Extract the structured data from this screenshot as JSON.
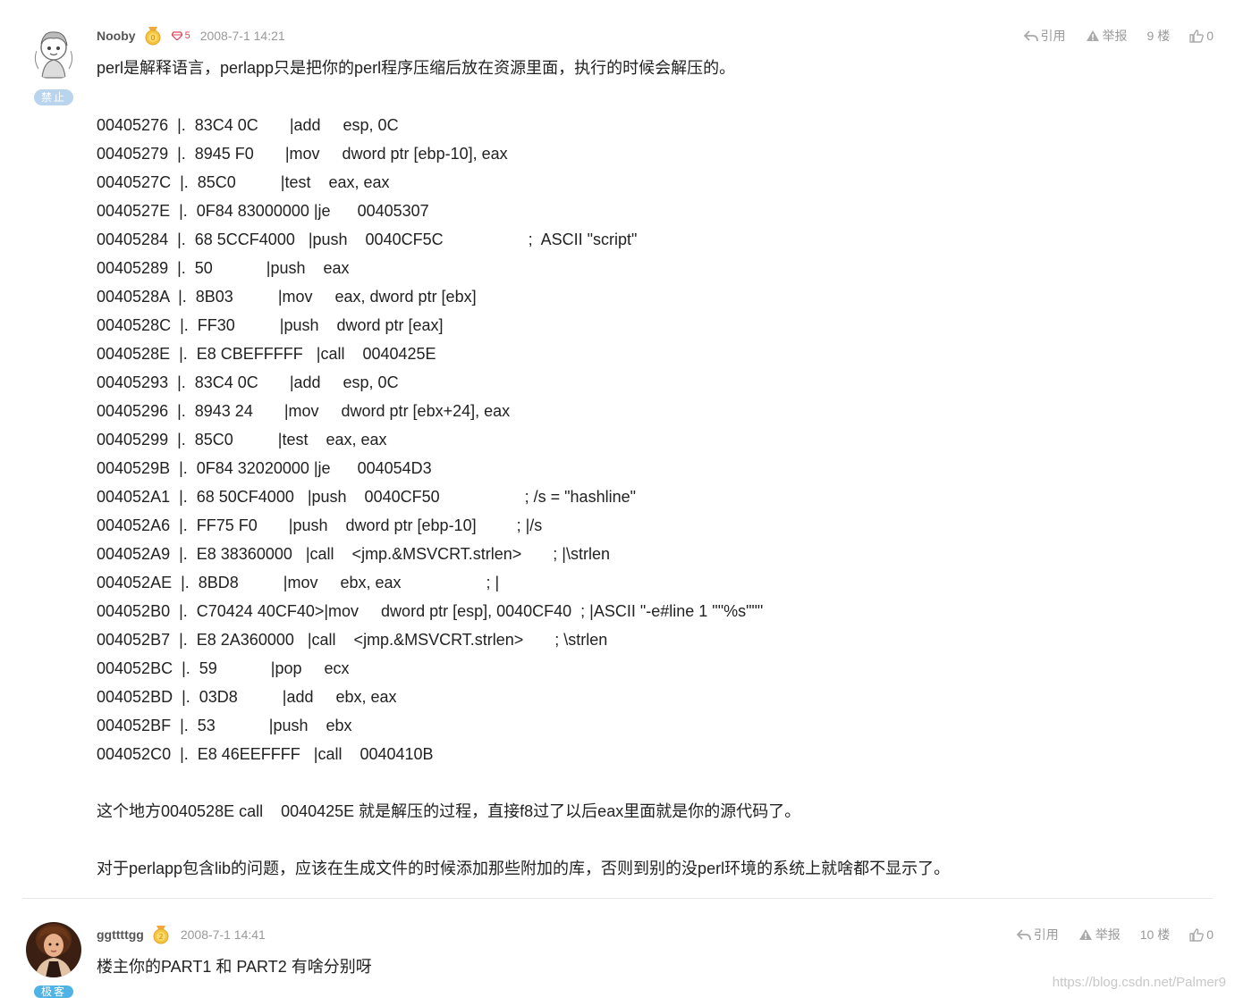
{
  "posts": [
    {
      "username": "Nooby",
      "gem_level": "5",
      "time": "2008-7-1 14:21",
      "badge": "禁止",
      "actions": {
        "quote": "引用",
        "report": "举报",
        "floor": "9 楼",
        "likes": "0"
      },
      "lines": [
        "perl是解释语言，perlapp只是把你的perl程序压缩后放在资源里面，执行的时候会解压的。",
        "",
        "00405276  |.  83C4 0C       |add     esp, 0C",
        "00405279  |.  8945 F0       |mov     dword ptr [ebp-10], eax",
        "0040527C  |.  85C0          |test    eax, eax",
        "0040527E  |.  0F84 83000000 |je      00405307",
        "00405284  |.  68 5CCF4000   |push    0040CF5C                   ;  ASCII \"script\"",
        "00405289  |.  50            |push    eax",
        "0040528A  |.  8B03          |mov     eax, dword ptr [ebx]",
        "0040528C  |.  FF30          |push    dword ptr [eax]",
        "0040528E  |.  E8 CBEFFFFF   |call    0040425E",
        "00405293  |.  83C4 0C       |add     esp, 0C",
        "00405296  |.  8943 24       |mov     dword ptr [ebx+24], eax",
        "00405299  |.  85C0          |test    eax, eax",
        "0040529B  |.  0F84 32020000 |je      004054D3",
        "004052A1  |.  68 50CF4000   |push    0040CF50                   ; /s = \"hashline\"",
        "004052A6  |.  FF75 F0       |push    dword ptr [ebp-10]         ; |/s",
        "004052A9  |.  E8 38360000   |call    <jmp.&MSVCRT.strlen>       ; |\\strlen",
        "004052AE  |.  8BD8          |mov     ebx, eax                   ; |",
        "004052B0  |.  C70424 40CF40>|mov     dword ptr [esp], 0040CF40  ; |ASCII \"-e#line 1 \"\"%s\"\"\"",
        "004052B7  |.  E8 2A360000   |call    <jmp.&MSVCRT.strlen>       ; \\strlen",
        "004052BC  |.  59            |pop     ecx",
        "004052BD  |.  03D8          |add     ebx, eax",
        "004052BF  |.  53            |push    ebx",
        "004052C0  |.  E8 46EEFFFF   |call    0040410B",
        "",
        "这个地方0040528E call    0040425E 就是解压的过程，直接f8过了以后eax里面就是你的源代码了。",
        "",
        "对于perlapp包含lib的问题，应该在生成文件的时候添加那些附加的库，否则到别的没perl环境的系统上就啥都不显示了。"
      ]
    },
    {
      "username": "ggttttgg",
      "level": "2",
      "time": "2008-7-1 14:41",
      "badge": "极客",
      "actions": {
        "quote": "引用",
        "report": "举报",
        "floor": "10 楼",
        "likes": "0"
      },
      "lines": [
        "楼主你的PART1 和 PART2 有啥分别呀"
      ]
    }
  ],
  "watermark": "https://blog.csdn.net/Palmer9",
  "colors": {
    "meta_gray": "#999999",
    "text": "#222222",
    "badge_blue": "#b9d5ee",
    "gem_red": "#e0405a",
    "medal_gold": "#f5c542"
  }
}
